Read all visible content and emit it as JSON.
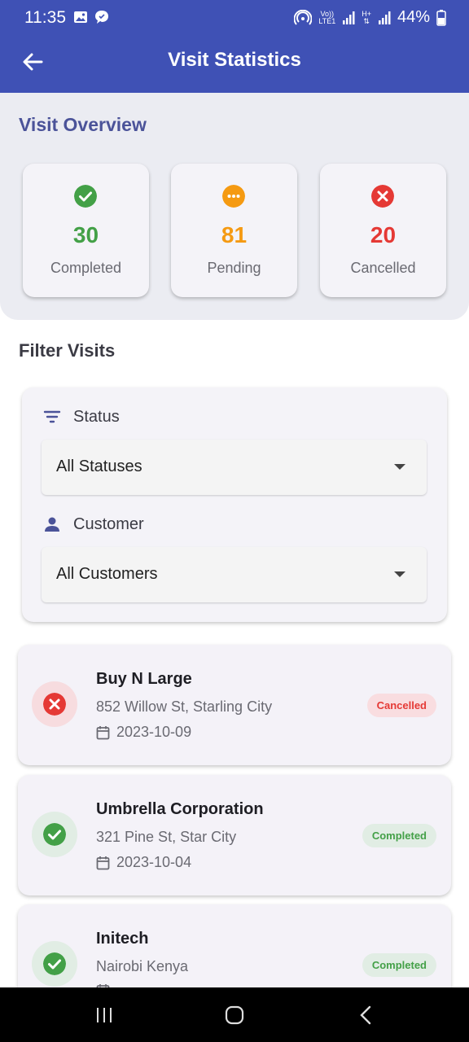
{
  "status_bar": {
    "time": "11:35",
    "net_top": "Vo))",
    "net_bottom": "LTE1",
    "net2": "H+",
    "battery": "44%"
  },
  "app_bar": {
    "title": "Visit Statistics",
    "back_icon": "arrow-left-icon",
    "color": "#3F51B5"
  },
  "overview": {
    "title": "Visit Overview",
    "stats": [
      {
        "count": "30",
        "label": "Completed",
        "icon": "check-circle-icon",
        "color": "#43A047"
      },
      {
        "count": "81",
        "label": "Pending",
        "icon": "more-horizontal-circle-icon",
        "color": "#F59A12"
      },
      {
        "count": "20",
        "label": "Cancelled",
        "icon": "x-circle-icon",
        "color": "#E53935"
      }
    ]
  },
  "filter": {
    "title": "Filter Visits",
    "status_label": "Status",
    "status_value": "All Statuses",
    "customer_label": "Customer",
    "customer_value": "All Customers"
  },
  "visits": [
    {
      "name": "Buy N Large",
      "address": "852 Willow St, Starling City",
      "date": "2023-10-09",
      "status": "Cancelled",
      "status_color": "#E53935"
    },
    {
      "name": "Umbrella Corporation",
      "address": "321 Pine St, Star City",
      "date": "2023-10-04",
      "status": "Completed",
      "status_color": "#43A047"
    },
    {
      "name": "Initech",
      "address": "Nairobi Kenya",
      "date": "",
      "status": "Completed",
      "status_color": "#43A047"
    }
  ]
}
